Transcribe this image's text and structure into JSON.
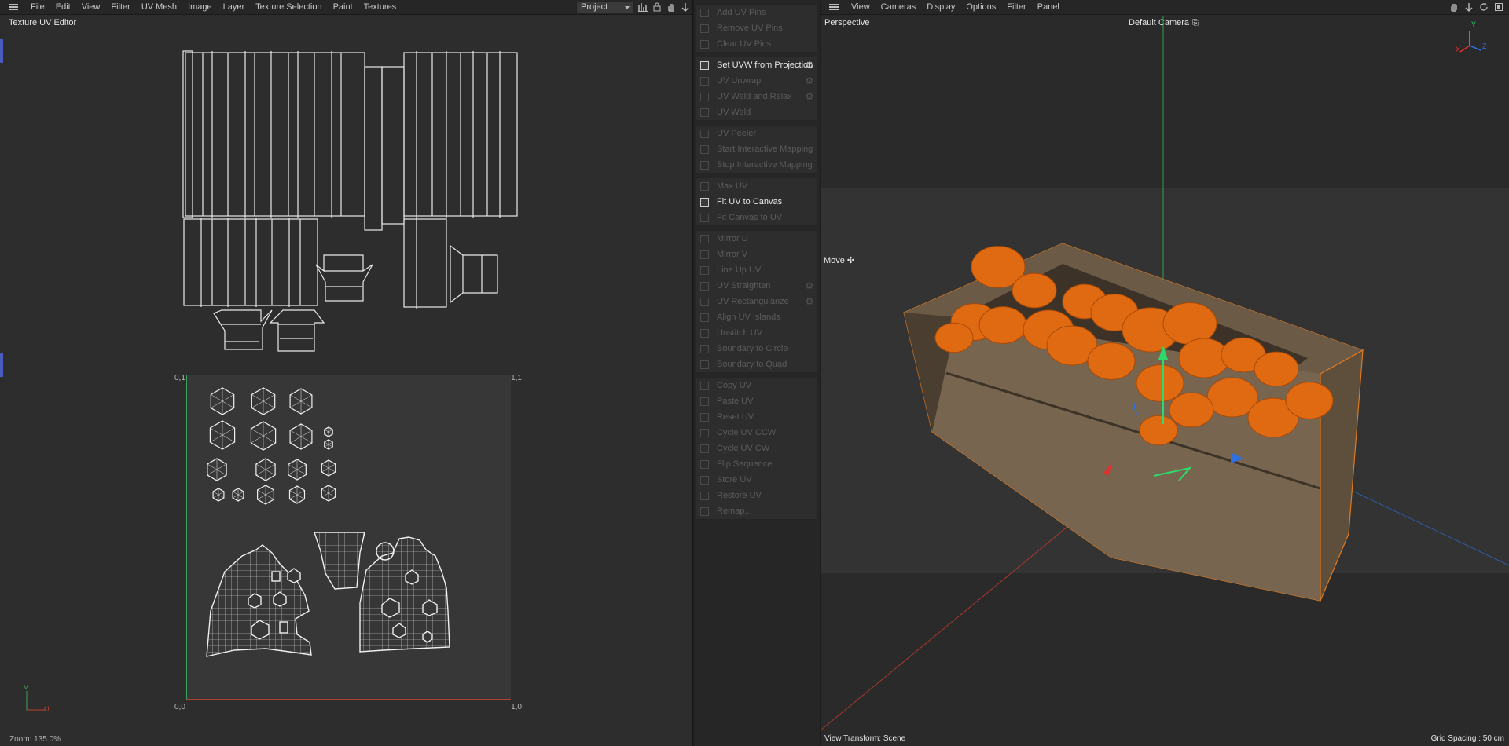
{
  "uv_editor": {
    "menu": [
      "File",
      "Edit",
      "View",
      "Filter",
      "UV Mesh",
      "Image",
      "Layer",
      "Texture Selection",
      "Paint",
      "Textures"
    ],
    "project_select": "Project",
    "title": "Texture UV Editor",
    "corner_labels": {
      "top_left": "0,1",
      "top_right": "1,1",
      "bottom_left": "0,0",
      "bottom_right": "1,0"
    },
    "axis_labels": {
      "v": "V",
      "u": "U"
    },
    "status": "Zoom: 135.0%",
    "icons": [
      "histogram-icon",
      "lock-icon",
      "hand-icon",
      "move-icon"
    ]
  },
  "tools": {
    "groups": [
      [
        {
          "label": "Add UV Pins",
          "active": false,
          "gear": false
        },
        {
          "label": "Remove UV Pins",
          "active": false,
          "gear": false
        },
        {
          "label": "Clear UV Pins",
          "active": false,
          "gear": false
        }
      ],
      [
        {
          "label": "Set UVW from Projection",
          "active": true,
          "gear": true
        },
        {
          "label": "UV Unwrap",
          "active": false,
          "gear": true
        },
        {
          "label": "UV Weld and Relax",
          "active": false,
          "gear": true
        },
        {
          "label": "UV Weld",
          "active": false,
          "gear": false
        }
      ],
      [
        {
          "label": "UV Peeler",
          "active": false,
          "gear": false
        },
        {
          "label": "Start Interactive Mapping",
          "active": false,
          "gear": false
        },
        {
          "label": "Stop Interactive Mapping",
          "active": false,
          "gear": false
        }
      ],
      [
        {
          "label": "Max UV",
          "active": false,
          "gear": false
        },
        {
          "label": "Fit UV to Canvas",
          "active": true,
          "gear": false
        },
        {
          "label": "Fit Canvas to UV",
          "active": false,
          "gear": false
        }
      ],
      [
        {
          "label": "Mirror U",
          "active": false,
          "gear": false
        },
        {
          "label": "Mirror V",
          "active": false,
          "gear": false
        },
        {
          "label": "Line Up UV",
          "active": false,
          "gear": false
        },
        {
          "label": "UV Straighten",
          "active": false,
          "gear": true
        },
        {
          "label": "UV Rectangularize",
          "active": false,
          "gear": true
        },
        {
          "label": "Align UV Islands",
          "active": false,
          "gear": false
        },
        {
          "label": "Unstitch UV",
          "active": false,
          "gear": false
        },
        {
          "label": "Boundary to Circle",
          "active": false,
          "gear": false
        },
        {
          "label": "Boundary to Quad",
          "active": false,
          "gear": false
        }
      ],
      [
        {
          "label": "Copy UV",
          "active": false,
          "gear": false
        },
        {
          "label": "Paste UV",
          "active": false,
          "gear": false
        },
        {
          "label": "Reset UV",
          "active": false,
          "gear": false
        },
        {
          "label": "Cycle UV CCW",
          "active": false,
          "gear": false
        },
        {
          "label": "Cycle UV CW",
          "active": false,
          "gear": false
        },
        {
          "label": "Flip Sequence",
          "active": false,
          "gear": false
        },
        {
          "label": "Store UV",
          "active": false,
          "gear": false
        },
        {
          "label": "Restore UV",
          "active": false,
          "gear": false
        },
        {
          "label": "Remap...",
          "active": false,
          "gear": false
        }
      ]
    ]
  },
  "viewport": {
    "menu": [
      "View",
      "Cameras",
      "Display",
      "Options",
      "Filter",
      "Panel"
    ],
    "mode": "Perspective",
    "camera": "Default Camera",
    "tool": "Move",
    "view_transform": "View Transform: Scene",
    "grid_spacing": "Grid Spacing : 50 cm",
    "axis_labels": {
      "y": "Y",
      "x": "X",
      "z": "Z"
    },
    "icons": [
      "hand-icon",
      "move-icon",
      "rotate-icon",
      "maximize-icon"
    ]
  }
}
